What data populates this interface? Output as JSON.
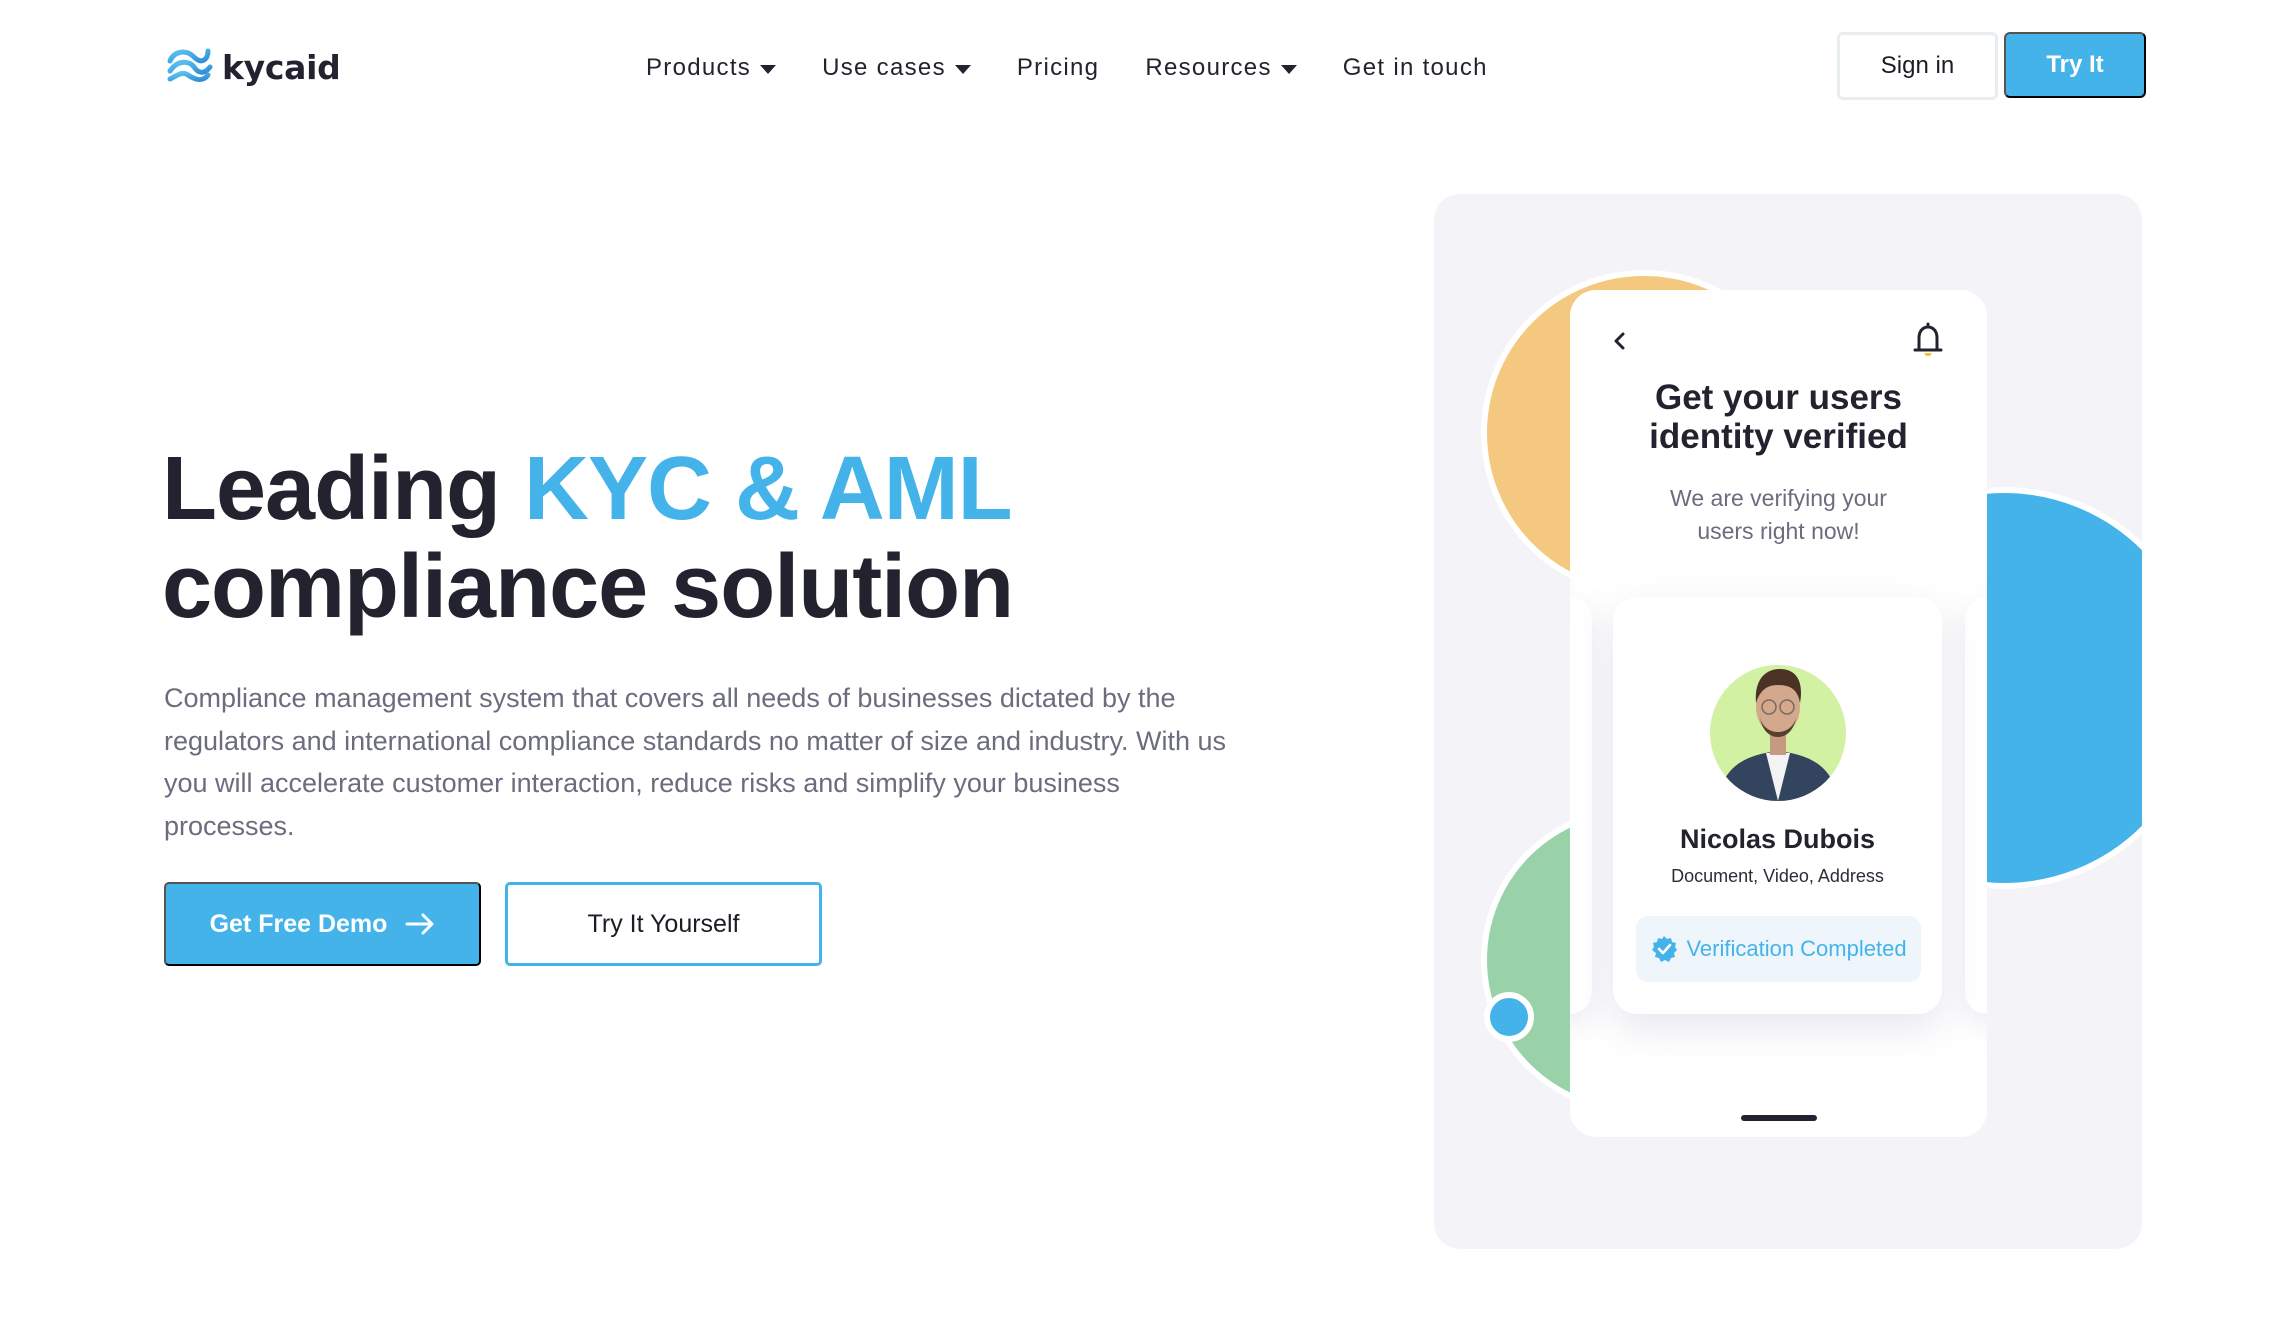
{
  "brand": {
    "name": "kycaid",
    "logo_icon": "kycaid-swirl-logo-icon",
    "accent_color": "#44b3ea"
  },
  "nav": {
    "items": [
      {
        "label": "Products",
        "has_dropdown": true
      },
      {
        "label": "Use cases",
        "has_dropdown": true
      },
      {
        "label": "Pricing",
        "has_dropdown": false
      },
      {
        "label": "Resources",
        "has_dropdown": true
      },
      {
        "label": "Get in touch",
        "has_dropdown": false
      }
    ],
    "sign_in_label": "Sign in",
    "try_it_label": "Try It"
  },
  "hero": {
    "title_prefix": "Leading ",
    "title_accent": "KYC & AML",
    "title_line2": "compliance solution",
    "description": "Compliance management system that covers all needs of businesses dictated by the regulators and international compliance standards no matter of size and industry. With us you will accelerate customer interaction, reduce risks and simplify your business processes.",
    "primary_cta": "Get Free Demo",
    "primary_cta_icon": "arrow-right-icon",
    "secondary_cta": "Try It Yourself"
  },
  "illustration": {
    "colors": {
      "yellow": "#f4c87e",
      "blue": "#44b3ea",
      "green": "#99d1a8",
      "panel_bg": "#f3f3f8"
    },
    "phone": {
      "back_icon": "chevron-left-icon",
      "notification_icon": "bell-icon",
      "title": "Get your users identity verified",
      "subtitle": "We are verifying your users right now!",
      "profile": {
        "name": "Nicolas Dubois",
        "checks": "Document, Video, Address",
        "status": "Verification Completed",
        "status_icon": "verified-badge-icon"
      }
    }
  }
}
